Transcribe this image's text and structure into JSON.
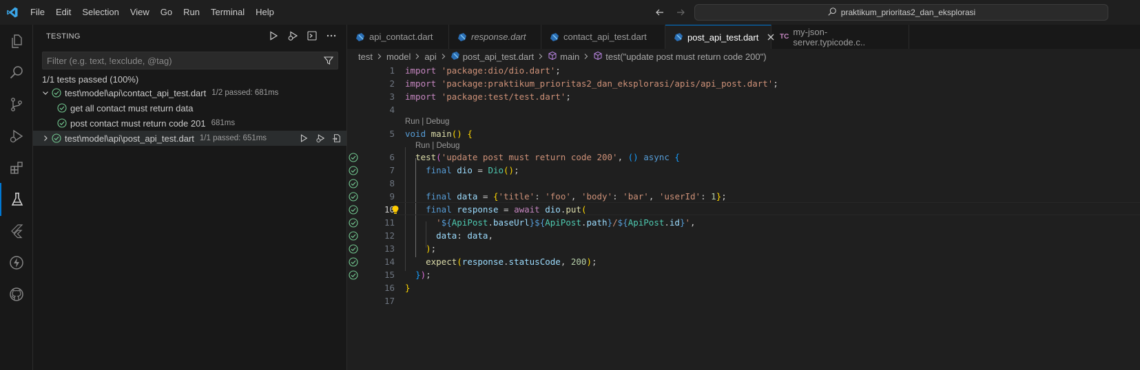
{
  "menu": [
    "File",
    "Edit",
    "Selection",
    "View",
    "Go",
    "Run",
    "Terminal",
    "Help"
  ],
  "command_center": "praktikum_prioritas2_dan_eksplorasi",
  "sidebar": {
    "title": "TESTING",
    "filter_placeholder": "Filter (e.g. text, !exclude, @tag)",
    "summary": "1/1 tests passed (100%)",
    "tree": [
      {
        "label": "test\\model\\api\\contact_api_test.dart",
        "meta": "1/2 passed: 681ms"
      },
      {
        "label": "get all contact must return data",
        "meta": ""
      },
      {
        "label": "post contact must return code 201",
        "meta": "681ms"
      },
      {
        "label": "test\\model\\api\\post_api_test.dart",
        "meta": "1/1 passed: 651ms"
      }
    ]
  },
  "tabs": [
    {
      "label": "api_contact.dart"
    },
    {
      "label": "response.dart"
    },
    {
      "label": "contact_api_test.dart"
    },
    {
      "label": "post_api_test.dart"
    },
    {
      "label": "my-json-server.typicode.c..",
      "icon": "TC"
    }
  ],
  "breadcrumb": [
    "test",
    "model",
    "api",
    "post_api_test.dart",
    "main",
    "test(\"update post must return code 200\")"
  ],
  "code_lens": "Run | Debug",
  "line_numbers": [
    "1",
    "2",
    "3",
    "4",
    "5",
    "6",
    "7",
    "8",
    "9",
    "10",
    "11",
    "12",
    "13",
    "14",
    "15",
    "16",
    "17"
  ],
  "colors": {
    "accent": "#0078d4",
    "pass": "#73c991",
    "bulb": "#ffcc00"
  }
}
